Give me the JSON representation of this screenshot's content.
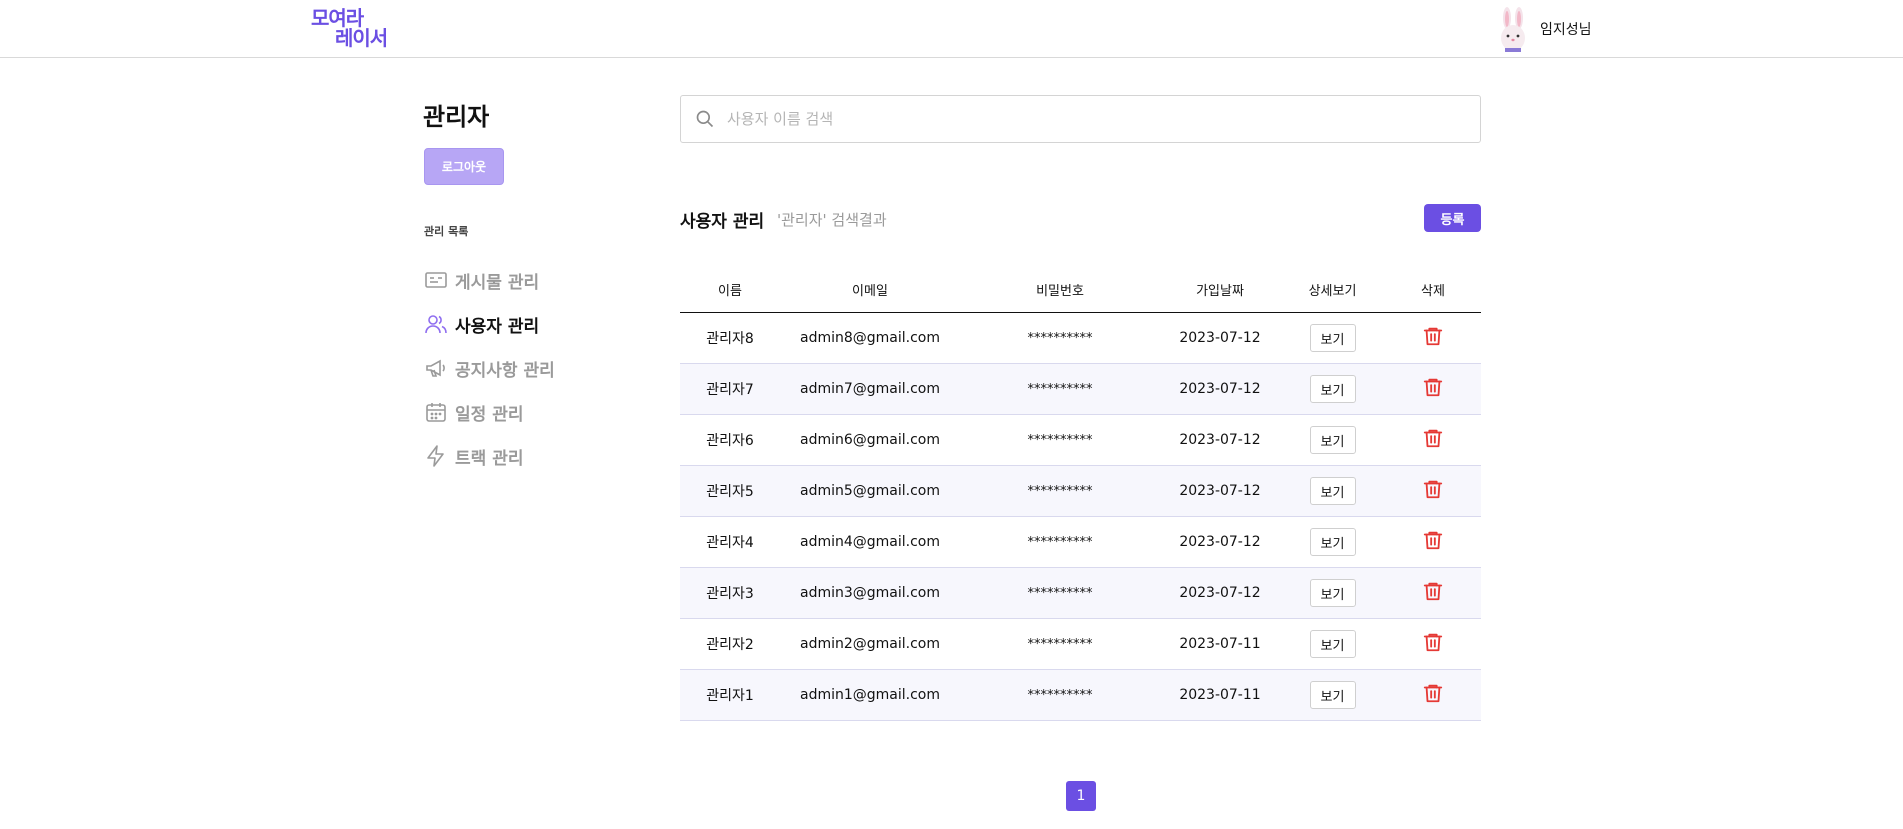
{
  "header": {
    "logo_line1": "모여라",
    "logo_line2": "레이서",
    "user_name": "임지성님"
  },
  "sidebar": {
    "title": "관리자",
    "logout_label": "로그아웃",
    "caption": "관리 목록",
    "items": [
      {
        "label": "게시물 관리",
        "icon": "id-card-icon",
        "active": false
      },
      {
        "label": "사용자 관리",
        "icon": "users-icon",
        "active": true
      },
      {
        "label": "공지사항 관리",
        "icon": "megaphone-icon",
        "active": false
      },
      {
        "label": "일정 관리",
        "icon": "calendar-icon",
        "active": false
      },
      {
        "label": "트랙 관리",
        "icon": "lightning-icon",
        "active": false
      }
    ]
  },
  "search": {
    "placeholder": "사용자 이름 검색",
    "value": ""
  },
  "section": {
    "title": "사용자 관리",
    "subtitle": "'관리자' 검색결과",
    "register_label": "등록"
  },
  "table": {
    "headers": [
      "이름",
      "이메일",
      "비밀번호",
      "가입날짜",
      "상세보기",
      "삭제"
    ],
    "view_label": "보기",
    "rows": [
      {
        "name": "관리자8",
        "email": "admin8@gmail.com",
        "password": "**********",
        "date": "2023-07-12"
      },
      {
        "name": "관리자7",
        "email": "admin7@gmail.com",
        "password": "**********",
        "date": "2023-07-12"
      },
      {
        "name": "관리자6",
        "email": "admin6@gmail.com",
        "password": "**********",
        "date": "2023-07-12"
      },
      {
        "name": "관리자5",
        "email": "admin5@gmail.com",
        "password": "**********",
        "date": "2023-07-12"
      },
      {
        "name": "관리자4",
        "email": "admin4@gmail.com",
        "password": "**********",
        "date": "2023-07-12"
      },
      {
        "name": "관리자3",
        "email": "admin3@gmail.com",
        "password": "**********",
        "date": "2023-07-12"
      },
      {
        "name": "관리자2",
        "email": "admin2@gmail.com",
        "password": "**********",
        "date": "2023-07-11"
      },
      {
        "name": "관리자1",
        "email": "admin1@gmail.com",
        "password": "**********",
        "date": "2023-07-11"
      }
    ]
  },
  "pagination": {
    "current_page": "1"
  },
  "colors": {
    "accent": "#6b4fe3",
    "accent_light": "#b7a6f5",
    "delete": "#e53935",
    "active_icon": "#8f6ef0",
    "inactive": "#9a9a9a"
  }
}
